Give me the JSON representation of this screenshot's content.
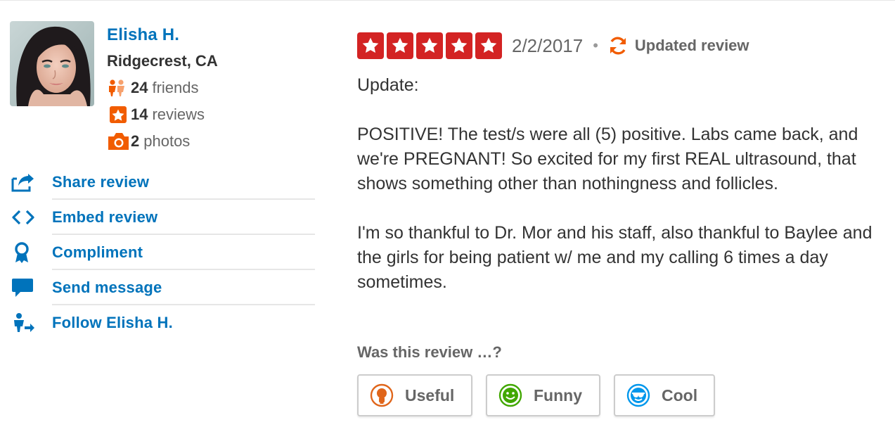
{
  "user": {
    "name": "Elisha H.",
    "location": "Ridgecrest, CA",
    "stats": [
      {
        "icon": "friends-icon",
        "count": "24",
        "label": "friends"
      },
      {
        "icon": "reviews-star-icon",
        "count": "14",
        "label": "reviews"
      },
      {
        "icon": "camera-icon",
        "count": "2",
        "label": "photos"
      }
    ]
  },
  "actions": [
    {
      "icon": "share-icon",
      "label": "Share review"
    },
    {
      "icon": "embed-code-icon",
      "label": "Embed review"
    },
    {
      "icon": "award-ribbon-icon",
      "label": "Compliment"
    },
    {
      "icon": "speech-bubble-icon",
      "label": "Send message"
    },
    {
      "icon": "follow-user-icon",
      "label": "Follow Elisha H."
    }
  ],
  "review": {
    "rating": 5,
    "max_rating": 5,
    "date": "2/2/2017",
    "separator": "•",
    "updated_label": "Updated review",
    "paragraphs": [
      "Update:",
      "POSITIVE!  The test/s were all (5) positive.  Labs came back, and we're PREGNANT!  So excited for my first REAL ultrasound, that shows something other than nothingness and follicles.",
      "I'm so thankful to Dr. Mor and his staff, also thankful to Baylee and the girls for being patient w/ me and my calling 6 times a day sometimes."
    ]
  },
  "votes": {
    "question": "Was this review …?",
    "buttons": [
      {
        "icon": "lightbulb-icon",
        "label": "Useful",
        "color": "#e0661b"
      },
      {
        "icon": "smiley-icon",
        "label": "Funny",
        "color": "#41a700"
      },
      {
        "icon": "sunglasses-smiley-icon",
        "label": "Cool",
        "color": "#0097ec"
      }
    ]
  },
  "colors": {
    "link_blue": "#0073bb",
    "star_red": "#d32323",
    "stat_orange": "#f15c00"
  }
}
